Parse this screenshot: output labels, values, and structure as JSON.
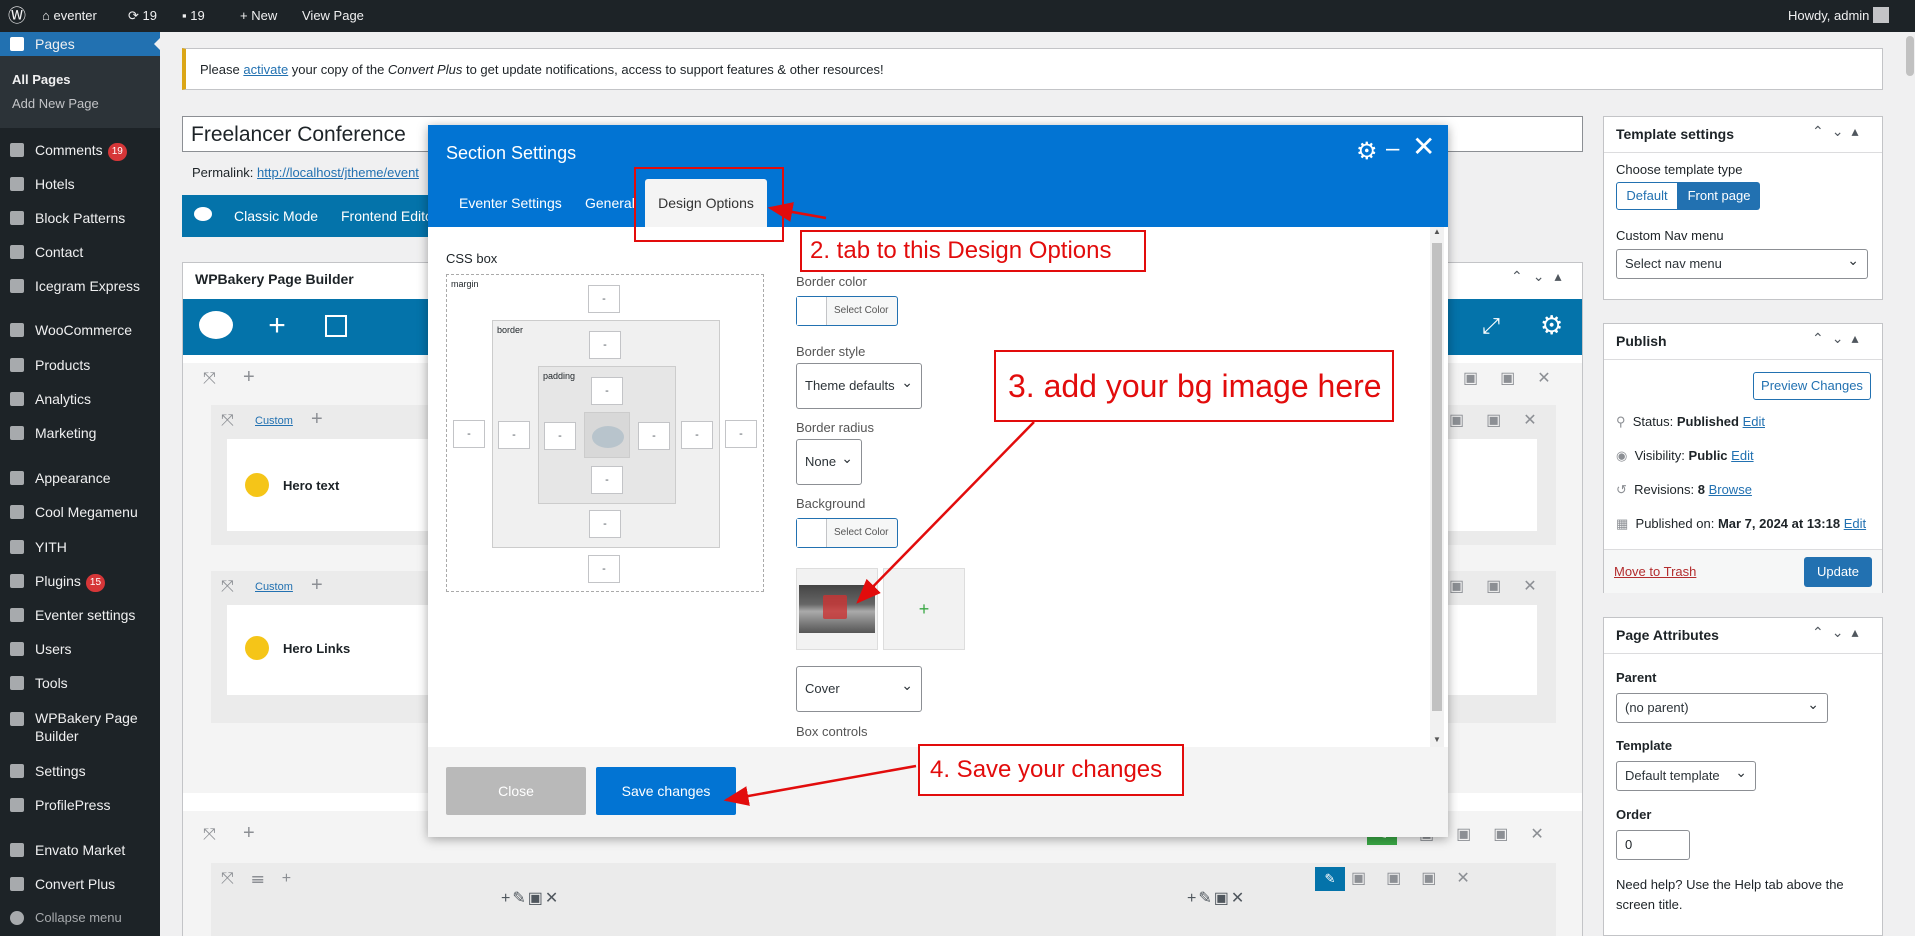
{
  "admin_bar": {
    "site_name": "eventer",
    "updates_count": "19",
    "comments_count": "19",
    "new_label": "New",
    "view_label": "View Page",
    "howdy": "Howdy, admin"
  },
  "menu": {
    "pages": "Pages",
    "all_pages": "All Pages",
    "add_new_page": "Add New Page",
    "comments": "Comments",
    "comments_badge": "19",
    "hotels": "Hotels",
    "block_patterns": "Block Patterns",
    "contact": "Contact",
    "icegram": "Icegram Express",
    "woocommerce": "WooCommerce",
    "products": "Products",
    "analytics": "Analytics",
    "marketing": "Marketing",
    "appearance": "Appearance",
    "cool_megamenu": "Cool Megamenu",
    "yith": "YITH",
    "plugins": "Plugins",
    "plugins_badge": "15",
    "eventer_settings": "Eventer settings",
    "users": "Users",
    "tools": "Tools",
    "wpbakery_1": "WPBakery Page",
    "wpbakery_2": "Builder",
    "settings": "Settings",
    "profilepress": "ProfilePress",
    "envato": "Envato Market",
    "convert_plus": "Convert Plus",
    "collapse": "Collapse menu"
  },
  "notice": {
    "before": "Please ",
    "link": "activate",
    "middle": " your copy of the ",
    "product": "Convert Plus",
    "after": " to get update notifications, access to support features & other resources!"
  },
  "editor": {
    "title": "Freelancer Conference",
    "permalink_label": "Permalink:",
    "permalink_url": "http://localhost/jtheme/event",
    "classic_mode": "Classic Mode",
    "frontend_editor": "Frontend Edito",
    "builder_title": "WPBakery Page Builder",
    "custom_label": "Custom",
    "hero_text": "Hero text",
    "hero_links": "Hero Links"
  },
  "modal": {
    "title": "Section Settings",
    "tabs": [
      "Eventer Settings",
      "General",
      "Design Options"
    ],
    "css_box": "CSS box",
    "margin": "margin",
    "border": "border",
    "padding": "padding",
    "dash": "-",
    "border_color_label": "Border color",
    "select_color": "Select Color",
    "border_style_label": "Border style",
    "border_style_value": "Theme defaults",
    "border_radius_label": "Border radius",
    "border_radius_value": "None",
    "background_label": "Background",
    "background_size_value": "Cover",
    "box_controls": "Box controls",
    "plus": "+",
    "close": "Close",
    "save": "Save changes"
  },
  "annotations": {
    "tab": "2. tab to this Design Options",
    "bg": "3. add your bg image here",
    "save": "4. Save your changes"
  },
  "template_settings": {
    "title": "Template settings",
    "choose_type": "Choose template type",
    "default": "Default",
    "front_page": "Front page",
    "nav_label": "Custom Nav menu",
    "nav_value": "Select nav menu"
  },
  "publish": {
    "title": "Publish",
    "preview": "Preview Changes",
    "status_label": "Status: ",
    "status_value": "Published",
    "visibility_label": "Visibility: ",
    "visibility_value": "Public",
    "revisions_label": "Revisions: ",
    "revisions_value": "8",
    "browse": "Browse",
    "published_label": "Published on: ",
    "published_value": "Mar 7, 2024 at 13:18",
    "edit": "Edit",
    "trash": "Move to Trash",
    "update": "Update"
  },
  "page_attributes": {
    "title": "Page Attributes",
    "parent_label": "Parent",
    "parent_value": "(no parent)",
    "template_label": "Template",
    "template_value": "Default template",
    "order_label": "Order",
    "order_value": "0",
    "help": "Need help? Use the Help tab above the screen title."
  },
  "colors": {
    "wp_blue": "#2271b1",
    "vc_blue": "#0473aa",
    "modal_blue": "#0274d3",
    "annotation_red": "#e20c0c",
    "admin_dark": "#1d2327"
  }
}
